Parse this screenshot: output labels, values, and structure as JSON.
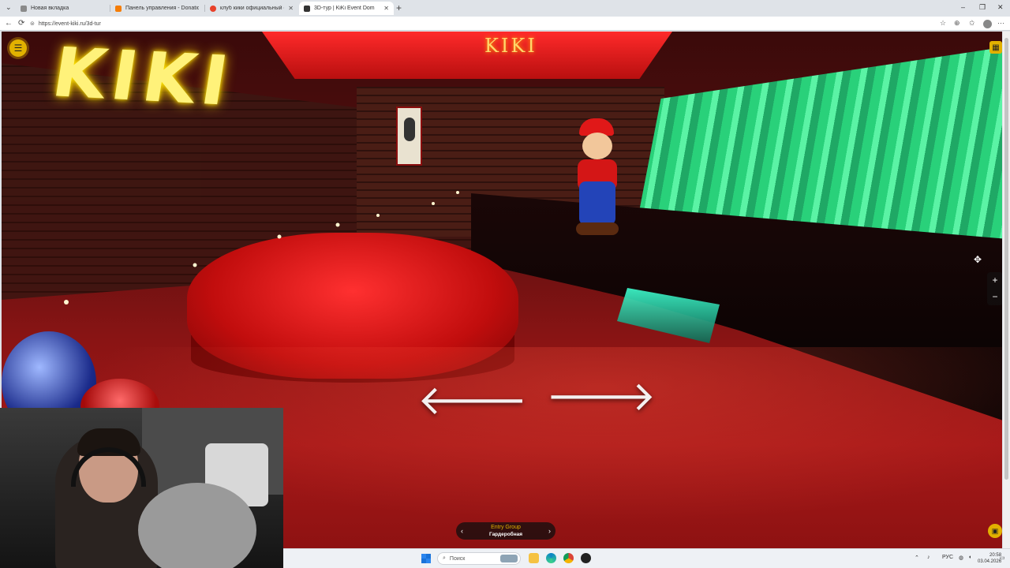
{
  "browser": {
    "tabs": [
      {
        "title": "Новая вкладка",
        "favicon_color": "#8a8a8a",
        "active": false
      },
      {
        "title": "Панель управления - DonationAl",
        "favicon_color": "#f57d07",
        "active": false
      },
      {
        "title": "клуб кики официальный сайт —",
        "favicon_color": "#e8412a",
        "active": false
      },
      {
        "title": "3D-тур | KiKi Event Dom",
        "favicon_color": "#333333",
        "active": true
      }
    ],
    "new_tab_label": "+",
    "url": "https://event-kiki.ru/3d-tur",
    "window_controls": {
      "minimize": "–",
      "restore": "❐",
      "close": "✕"
    }
  },
  "tour": {
    "ceiling_logo": "KIKI",
    "neon_sign": "KIKI",
    "arrows": {
      "left": "🡐",
      "right": "🡒"
    },
    "zoom": {
      "in": "+",
      "out": "−"
    },
    "scene_nav": {
      "group": "Entry Group",
      "room": "Гардеробная",
      "prev": "‹",
      "next": "›"
    },
    "accent_color": "#e2b100"
  },
  "taskbar": {
    "search_placeholder": "Поиск",
    "language": "РУС",
    "time": "20:58",
    "date": "03.04.2026"
  }
}
